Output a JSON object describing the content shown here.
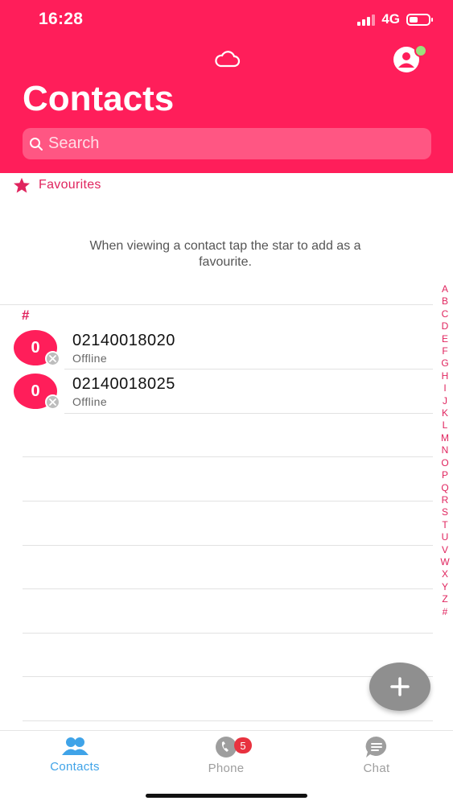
{
  "status_bar": {
    "time": "16:28",
    "network": "4G",
    "battery_level": 0.55
  },
  "header": {
    "title": "Contacts",
    "search_placeholder": "Search",
    "icons": {
      "cloud": "cloud-icon",
      "profile": "user-profile-icon"
    }
  },
  "favourites": {
    "label": "Favourites",
    "hint": "When viewing a contact tap the star to add as a favourite."
  },
  "contacts": {
    "section": "#",
    "items": [
      {
        "initial": "0",
        "number": "02140018020",
        "status": "Offline"
      },
      {
        "initial": "0",
        "number": "02140018025",
        "status": "Offline"
      }
    ]
  },
  "alpha_index": [
    "A",
    "B",
    "C",
    "D",
    "E",
    "F",
    "G",
    "H",
    "I",
    "J",
    "K",
    "L",
    "M",
    "N",
    "O",
    "P",
    "Q",
    "R",
    "S",
    "T",
    "U",
    "V",
    "W",
    "X",
    "Y",
    "Z",
    "#"
  ],
  "tabs": [
    {
      "label": "Contacts",
      "icon": "contacts-icon",
      "active": true
    },
    {
      "label": "Phone",
      "icon": "phone-icon",
      "badge": "5",
      "active": false
    },
    {
      "label": "Chat",
      "icon": "chat-icon",
      "active": false
    }
  ],
  "colors": {
    "brand": "#ff1e5a",
    "accent_text": "#e0245e",
    "tab_active": "#3fa3e8",
    "tab_inactive": "#9e9e9e",
    "fab": "#8f8f8f"
  }
}
